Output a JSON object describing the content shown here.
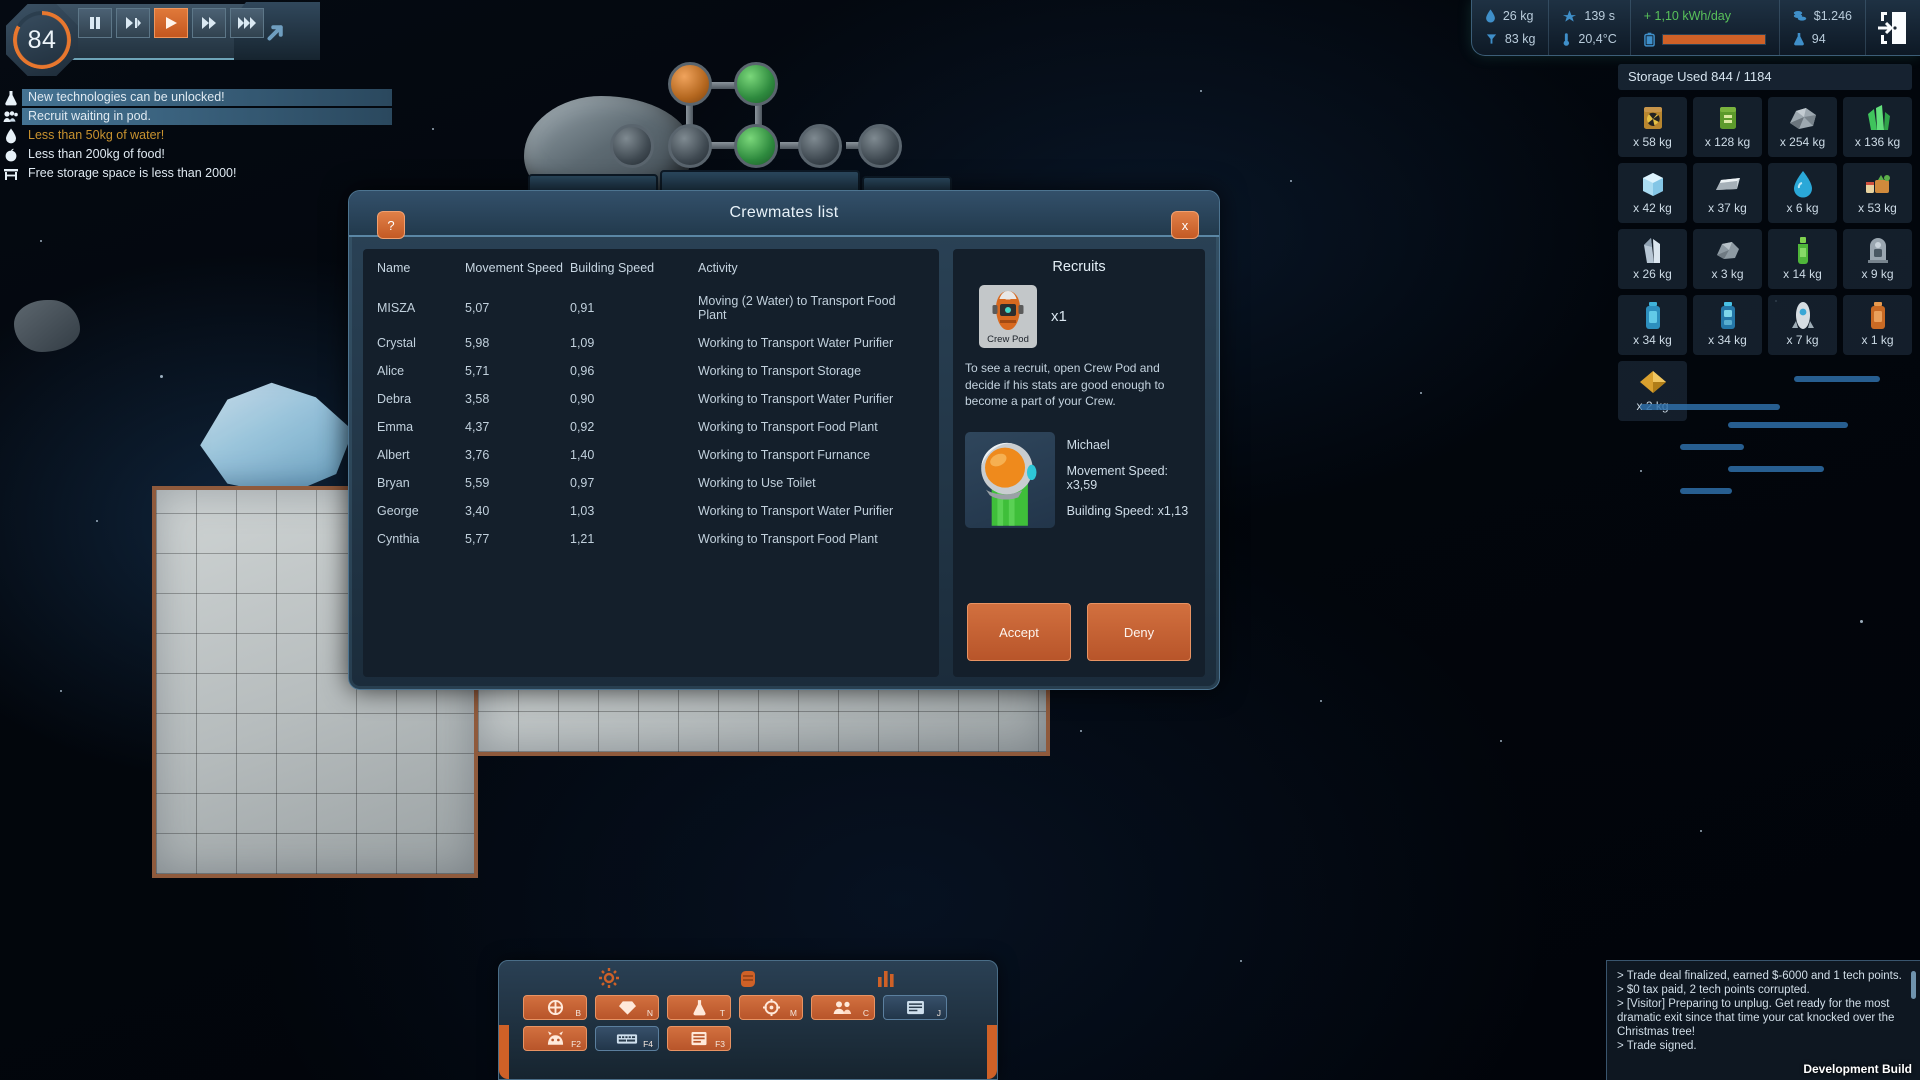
{
  "timebar": {
    "day_counter": "84",
    "speed_buttons": [
      {
        "name": "pause",
        "active": false
      },
      {
        "name": "slow",
        "active": false
      },
      {
        "name": "play",
        "active": true
      },
      {
        "name": "fast",
        "active": false
      },
      {
        "name": "fastest",
        "active": false
      }
    ]
  },
  "alerts": [
    {
      "icon": "flask-icon",
      "text": "New technologies can be unlocked!",
      "style": "highlight"
    },
    {
      "icon": "crew-icon",
      "text": "Recruit waiting in pod.",
      "style": "highlight"
    },
    {
      "icon": "water-drop-icon",
      "text": "Less than 50kg of water!",
      "style": "warning"
    },
    {
      "icon": "food-icon",
      "text": "Less than 200kg of food!",
      "style": "normal"
    },
    {
      "icon": "storage-icon",
      "text": "Free storage space is less than 2000!",
      "style": "normal"
    }
  ],
  "status": {
    "water": "26 kg",
    "food": "83 kg",
    "ship_timer": "139 s",
    "temperature": "20,4°C",
    "energy": "+ 1,10 kWh/day",
    "battery_percent": 100,
    "money": "$1.246",
    "science": "94"
  },
  "storage": {
    "title": "Storage Used 844 / 1184",
    "items": [
      {
        "icon": "radioactive-barrel-icon",
        "qty": "x 58 kg"
      },
      {
        "icon": "green-barrel-icon",
        "qty": "x 128 kg"
      },
      {
        "icon": "ore-rock-icon",
        "qty": "x 254 kg"
      },
      {
        "icon": "green-crystal-icon",
        "qty": "x 136 kg"
      },
      {
        "icon": "ice-cube-icon",
        "qty": "x 42 kg"
      },
      {
        "icon": "metal-ingot-icon",
        "qty": "x 37 kg"
      },
      {
        "icon": "water-drop-icon",
        "qty": "x 6 kg"
      },
      {
        "icon": "food-crate-icon",
        "qty": "x 53 kg"
      },
      {
        "icon": "crystal-shard-icon",
        "qty": "x 26 kg"
      },
      {
        "icon": "grey-rock-icon",
        "qty": "x 3 kg"
      },
      {
        "icon": "green-bottle-icon",
        "qty": "x 14 kg"
      },
      {
        "icon": "machine-part-icon",
        "qty": "x 9 kg"
      },
      {
        "icon": "blue-canister-icon",
        "qty": "x 34 kg"
      },
      {
        "icon": "blue-canister2-icon",
        "qty": "x 34 kg"
      },
      {
        "icon": "rocket-part-icon",
        "qty": "x 7 kg"
      },
      {
        "icon": "orange-canister-icon",
        "qty": "x 1 kg"
      },
      {
        "icon": "gold-plate-icon",
        "qty": "x 2 kg"
      }
    ]
  },
  "dialog": {
    "title": "Crewmates list",
    "help_label": "?",
    "close_label": "x",
    "table": {
      "columns": [
        "Name",
        "Movement Speed",
        "Building Speed",
        "Activity"
      ],
      "rows": [
        {
          "name": "MISZA",
          "movement": "5,07",
          "building": "0,91",
          "activity": "Moving (2 Water) to Transport Food Plant"
        },
        {
          "name": "Crystal",
          "movement": "5,98",
          "building": "1,09",
          "activity": "Working to Transport Water Purifier"
        },
        {
          "name": "Alice",
          "movement": "5,71",
          "building": "0,96",
          "activity": "Working to Transport Storage"
        },
        {
          "name": "Debra",
          "movement": "3,58",
          "building": "0,90",
          "activity": "Working to Transport Water Purifier"
        },
        {
          "name": "Emma",
          "movement": "4,37",
          "building": "0,92",
          "activity": "Working to Transport Food Plant"
        },
        {
          "name": "Albert",
          "movement": "3,76",
          "building": "1,40",
          "activity": "Working to Transport Furnance"
        },
        {
          "name": "Bryan",
          "movement": "5,59",
          "building": "0,97",
          "activity": "Working to Use Toilet"
        },
        {
          "name": "George",
          "movement": "3,40",
          "building": "1,03",
          "activity": "Working to Transport Water Purifier"
        },
        {
          "name": "Cynthia",
          "movement": "5,77",
          "building": "1,21",
          "activity": "Working to Transport Food Plant"
        }
      ]
    },
    "recruits": {
      "title": "Recruits",
      "pod_label": "Crew Pod",
      "pod_qty": "x1",
      "description": "To see a recruit, open Crew Pod and decide if his stats are good enough to become a part of your Crew.",
      "candidate": {
        "name": "Michael",
        "movement_speed": "Movement Speed: x3,59",
        "building_speed": "Building Speed: x1,13"
      },
      "accept_label": "Accept",
      "deny_label": "Deny"
    }
  },
  "toolbar": {
    "tabs": [
      {
        "icon": "gear-icon"
      },
      {
        "icon": "fist-icon"
      },
      {
        "icon": "chart-icon"
      }
    ],
    "row1": [
      {
        "icon": "build-icon",
        "key": "B",
        "style": "accent"
      },
      {
        "icon": "gem-icon",
        "key": "N",
        "style": "accent"
      },
      {
        "icon": "research-icon",
        "key": "T",
        "style": "accent"
      },
      {
        "icon": "target-icon",
        "key": "M",
        "style": "accent"
      },
      {
        "icon": "crew-icon",
        "key": "C",
        "style": "accent"
      },
      {
        "icon": "journal-icon",
        "key": "J",
        "style": "dark"
      }
    ],
    "row2": [
      {
        "icon": "creature-icon",
        "key": "F2",
        "style": "accent"
      },
      {
        "icon": "keyboard-icon",
        "key": "F4",
        "style": "dark"
      },
      {
        "icon": "list-icon",
        "key": "F3",
        "style": "accent"
      }
    ]
  },
  "console": {
    "lines": [
      "> Trade deal finalized, earned $-6000 and 1 tech points.",
      "> $0 tax paid, 2 tech points corrupted.",
      "> [Visitor] Preparing to unplug. Get ready for the most dramatic exit since that time your cat knocked over the Christmas tree!",
      "> Trade signed."
    ],
    "dev_build": "Development Build"
  },
  "colors": {
    "accent_orange": "#cf6127",
    "panel_blue": "#1b2c3b",
    "alert_highlight": "#4a7c9e",
    "warning_text": "#c8922f",
    "energy_green": "#58c05a"
  }
}
